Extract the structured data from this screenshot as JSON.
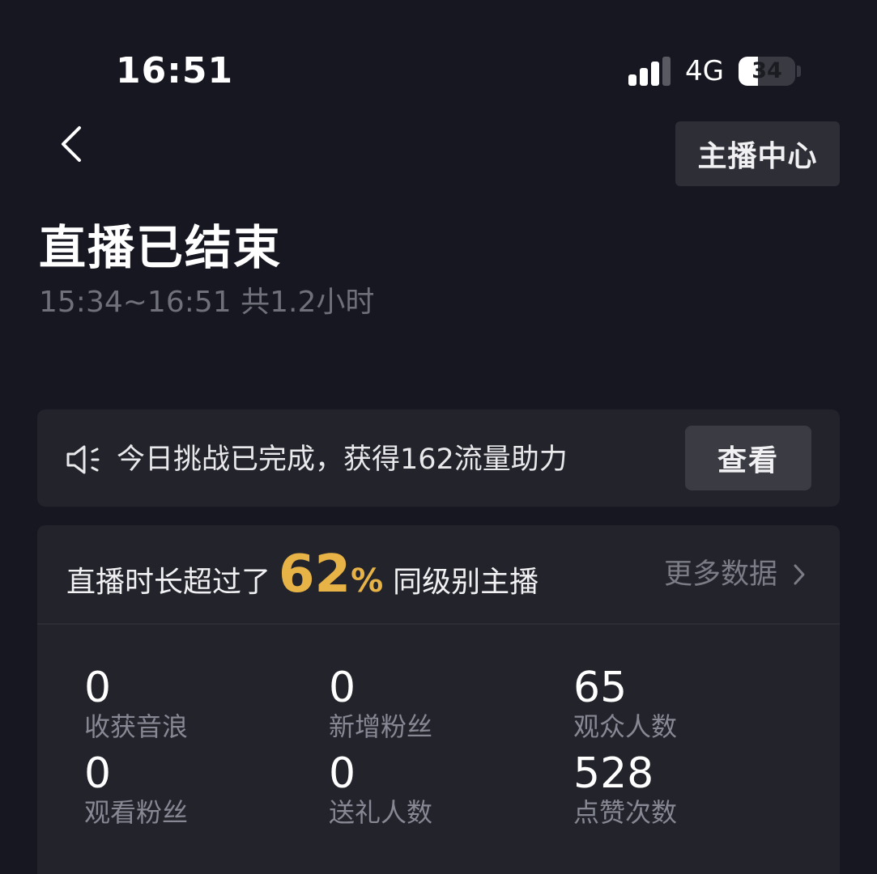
{
  "status_bar": {
    "time": "16:51",
    "network": "4G",
    "battery_level": "34",
    "battery_fraction": 0.34
  },
  "header": {
    "back_icon": "chevron-left-icon",
    "anchor_center_label": "主播中心"
  },
  "summary": {
    "title": "直播已结束",
    "session_time": "15:34~16:51 共1.2小时"
  },
  "challenge": {
    "icon": "speaker-icon",
    "text": "今日挑战已完成，获得162流量助力",
    "view_label": "查看"
  },
  "stats": {
    "ranking_prefix": "直播时长超过了",
    "ranking_percent": "62",
    "ranking_percent_sign": "%",
    "ranking_suffix": "同级别主播",
    "more_data_label": "更多数据",
    "items": [
      {
        "value": "0",
        "label": "收获音浪"
      },
      {
        "value": "0",
        "label": "新增粉丝"
      },
      {
        "value": "65",
        "label": "观众人数"
      },
      {
        "value": "0",
        "label": "观看粉丝"
      },
      {
        "value": "0",
        "label": "送礼人数"
      },
      {
        "value": "528",
        "label": "点赞次数"
      }
    ]
  },
  "colors": {
    "background": "#161720",
    "card": "#22232b",
    "accent": "#e7b347",
    "muted_text": "#878893"
  }
}
